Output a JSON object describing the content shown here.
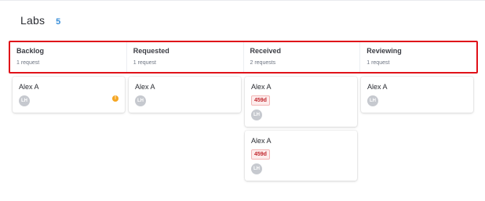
{
  "page": {
    "title": "Labs",
    "count": "5"
  },
  "columns": [
    {
      "title": "Backlog",
      "subtitle": "1 request"
    },
    {
      "title": "Requested",
      "subtitle": "1 request"
    },
    {
      "title": "Received",
      "subtitle": "2 requests"
    },
    {
      "title": "Reviewing",
      "subtitle": "1 request"
    }
  ],
  "cards": {
    "backlog_0": {
      "name": "Alex A",
      "avatar": "LH",
      "alert": "!"
    },
    "requested_0": {
      "name": "Alex A",
      "avatar": "LH"
    },
    "received_0": {
      "name": "Alex A",
      "tag": "459d",
      "avatar": "LH"
    },
    "received_1": {
      "name": "Alex A",
      "tag": "459d",
      "avatar": "LH"
    },
    "reviewing_0": {
      "name": "Alex A",
      "avatar": "LH"
    }
  },
  "colors": {
    "accent": "#3a8fd9",
    "highlight_border": "#e0121a",
    "tag_red": "#c0262d",
    "alert": "#f5a623",
    "avatar": "#c6c9cf"
  }
}
